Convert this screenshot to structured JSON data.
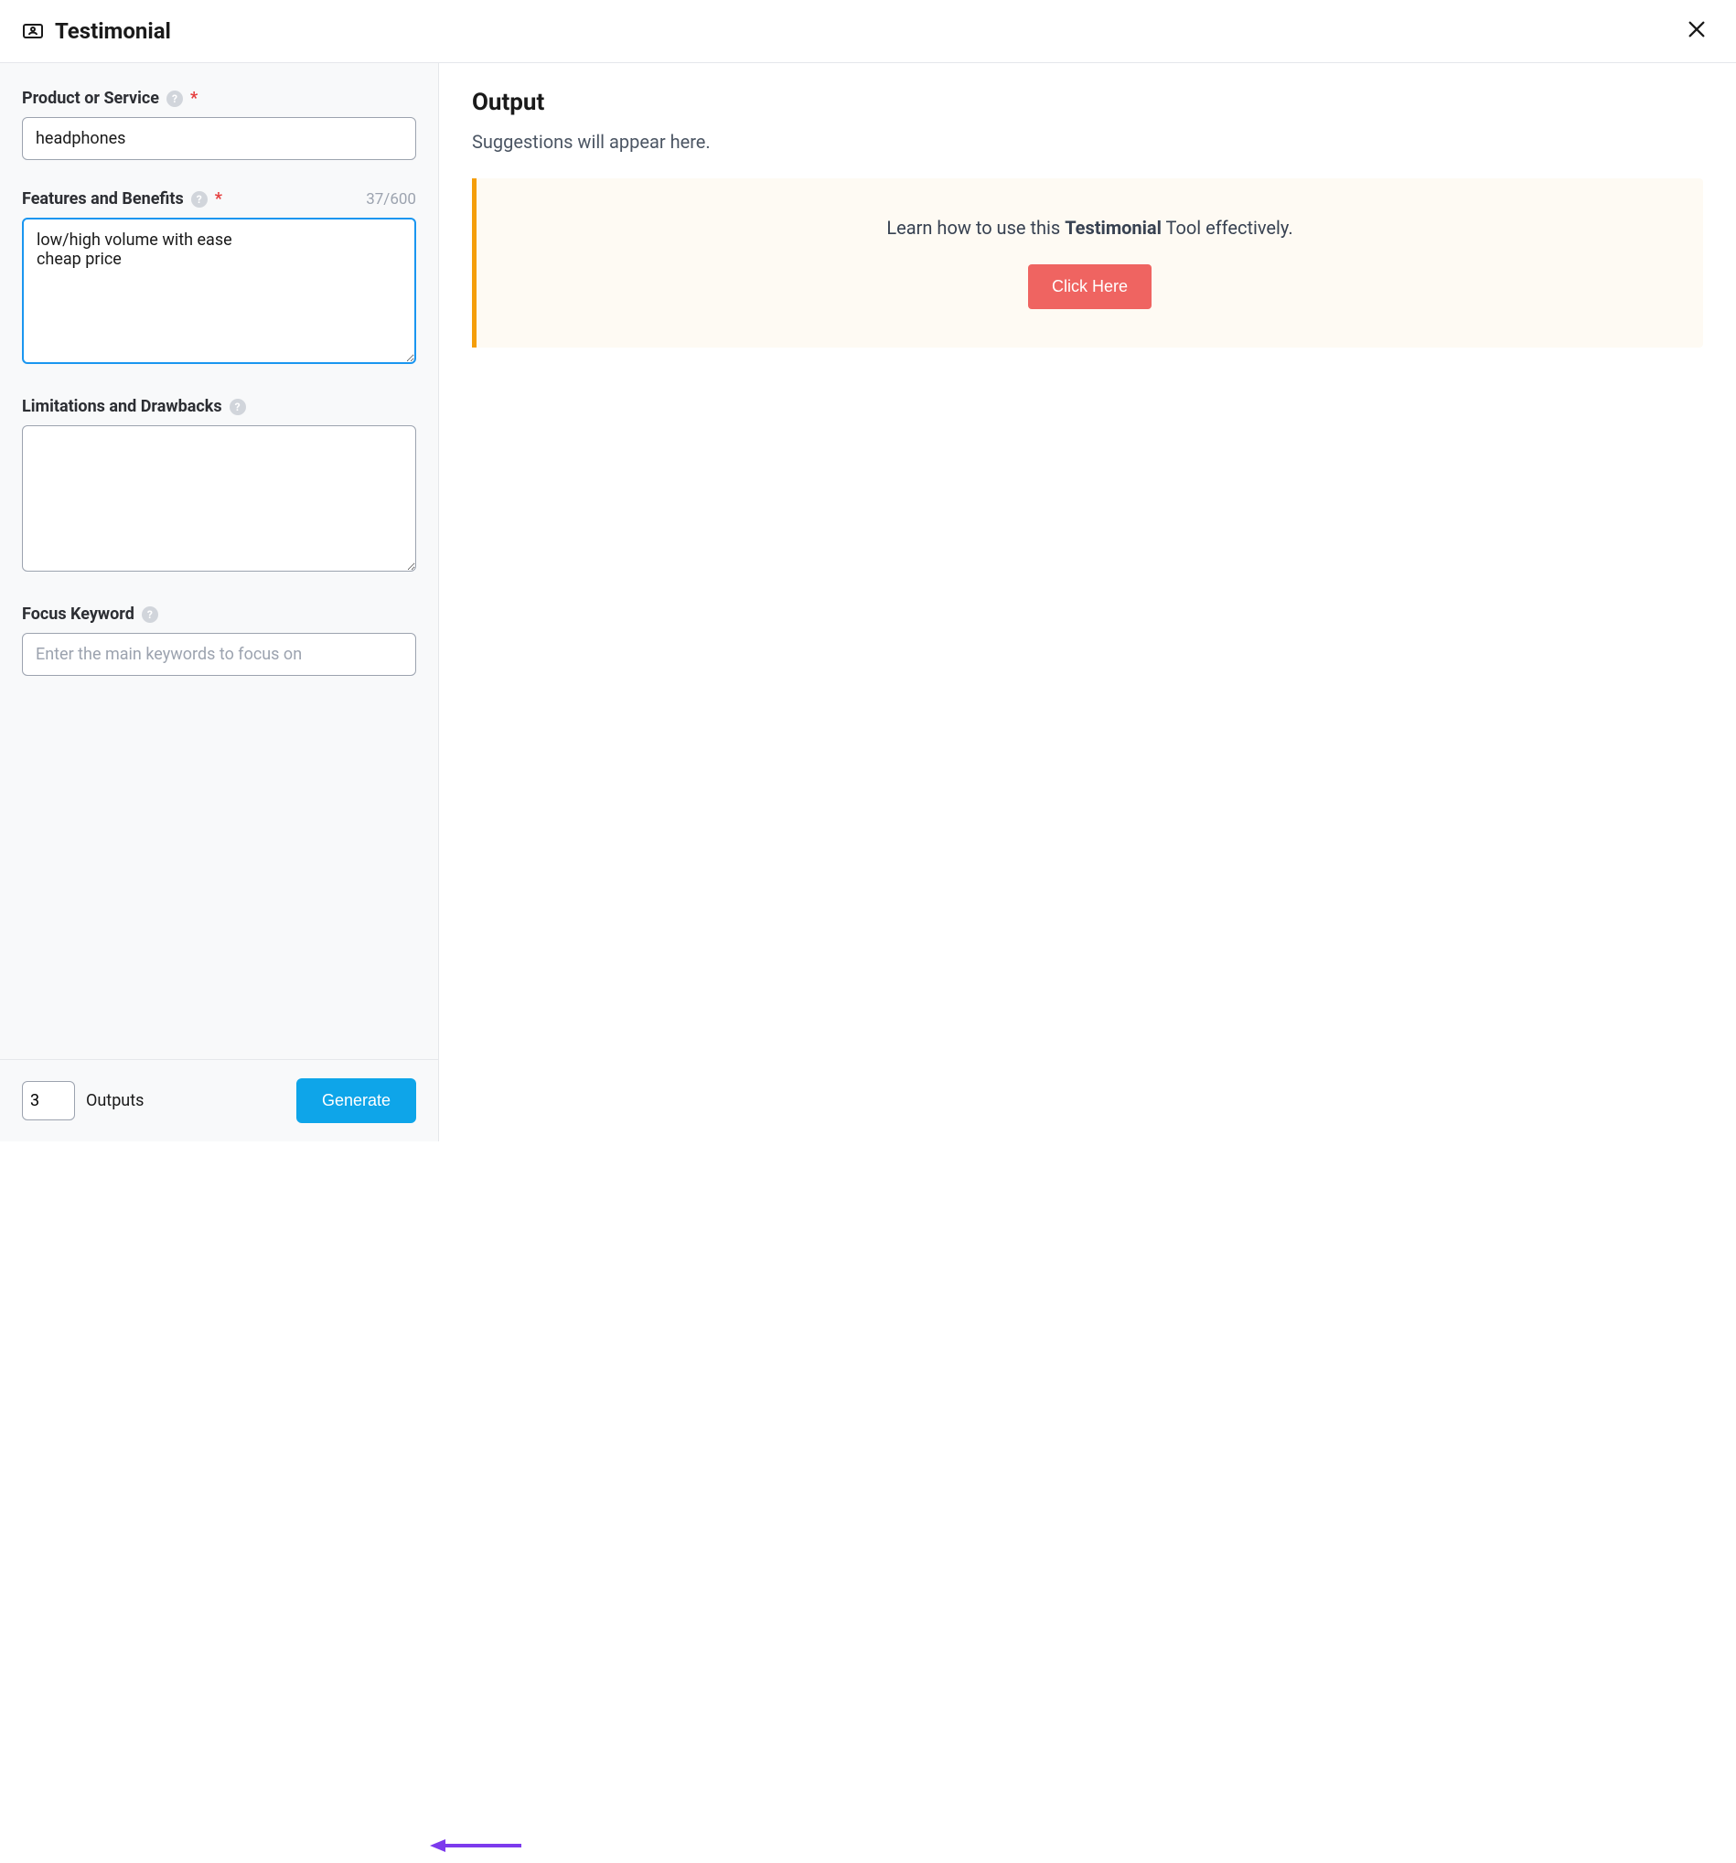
{
  "header": {
    "title": "Testimonial"
  },
  "form": {
    "product": {
      "label": "Product or Service",
      "value": "headphones"
    },
    "features": {
      "label": "Features and Benefits",
      "counter": "37/600",
      "value": "low/high volume with ease\ncheap price"
    },
    "limitations": {
      "label": "Limitations and Drawbacks",
      "value": ""
    },
    "focus": {
      "label": "Focus Keyword",
      "placeholder": "Enter the main keywords to focus on",
      "value": ""
    }
  },
  "footer": {
    "outputs_value": "3",
    "outputs_label": "Outputs",
    "generate_label": "Generate"
  },
  "output": {
    "title": "Output",
    "subtitle": "Suggestions will appear here.",
    "callout_prefix": "Learn how to use this ",
    "callout_bold": "Testimonial",
    "callout_suffix": " Tool effectively.",
    "callout_button": "Click Here"
  }
}
